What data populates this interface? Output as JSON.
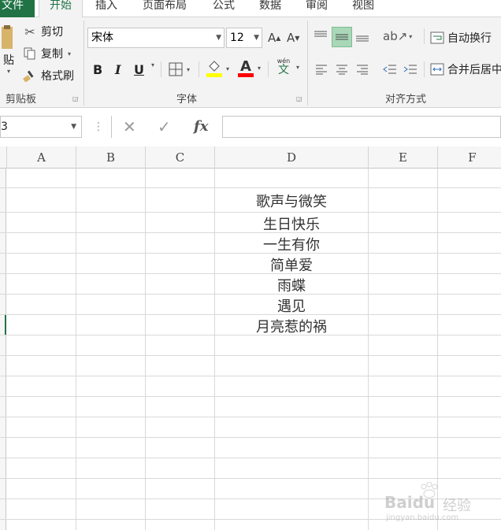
{
  "tabs": {
    "file": "文件",
    "items": [
      "开始",
      "插入",
      "页面布局",
      "公式",
      "数据",
      "审阅",
      "视图"
    ]
  },
  "clipboard": {
    "paste": "贴",
    "cut": "剪切",
    "copy": "复制",
    "format_painter": "格式刷",
    "group_label": "剪贴板"
  },
  "font": {
    "name": "宋体",
    "size": "12",
    "bold": "B",
    "italic": "I",
    "underline": "U",
    "font_color_letter": "A",
    "phonetic": "文",
    "phonetic_small": "wén",
    "group_label": "字体",
    "highlight_color": "#ffff00",
    "font_color": "#ff0000"
  },
  "alignment": {
    "wrap_text": "自动换行",
    "merge_center": "合并后居中",
    "group_label": "对齐方式"
  },
  "formula_bar": {
    "name_box": "3",
    "fx": "fx",
    "value": ""
  },
  "columns": [
    "A",
    "B",
    "C",
    "D",
    "E",
    "F"
  ],
  "cells": [
    "歌声与微笑",
    "生日快乐",
    "一生有你",
    "简单爱",
    "雨蝶",
    "遇见",
    "月亮惹的祸"
  ],
  "watermark": {
    "brand": "Baidu",
    "suffix": "经验",
    "url": "jingyan.baidu.com"
  },
  "colors": {
    "accent": "#217346"
  }
}
